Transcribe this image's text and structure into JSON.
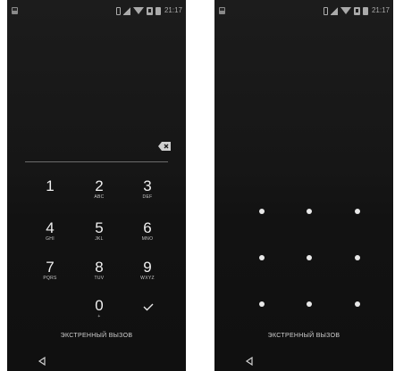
{
  "status_bar": {
    "time": "21:17"
  },
  "pin_screen": {
    "keys": [
      {
        "digit": "1",
        "letters": ""
      },
      {
        "digit": "2",
        "letters": "ABC"
      },
      {
        "digit": "3",
        "letters": "DEF"
      },
      {
        "digit": "4",
        "letters": "GHI"
      },
      {
        "digit": "5",
        "letters": "JKL"
      },
      {
        "digit": "6",
        "letters": "MNO"
      },
      {
        "digit": "7",
        "letters": "PQRS"
      },
      {
        "digit": "8",
        "letters": "TUV"
      },
      {
        "digit": "9",
        "letters": "WXYZ"
      },
      {
        "digit": "0",
        "letters": "+"
      }
    ],
    "emergency_label": "ЭКСТРЕННЫЙ ВЫЗОВ",
    "icons": {
      "backspace": "backspace-icon",
      "enter": "checkmark-icon",
      "back": "nav-back-icon"
    }
  },
  "pattern_screen": {
    "dot_count": 9,
    "emergency_label": "ЭКСТРЕННЫЙ ВЫЗОВ"
  },
  "colors": {
    "background": "#141414",
    "text": "#efefef",
    "dot": "#e8e8e8"
  }
}
